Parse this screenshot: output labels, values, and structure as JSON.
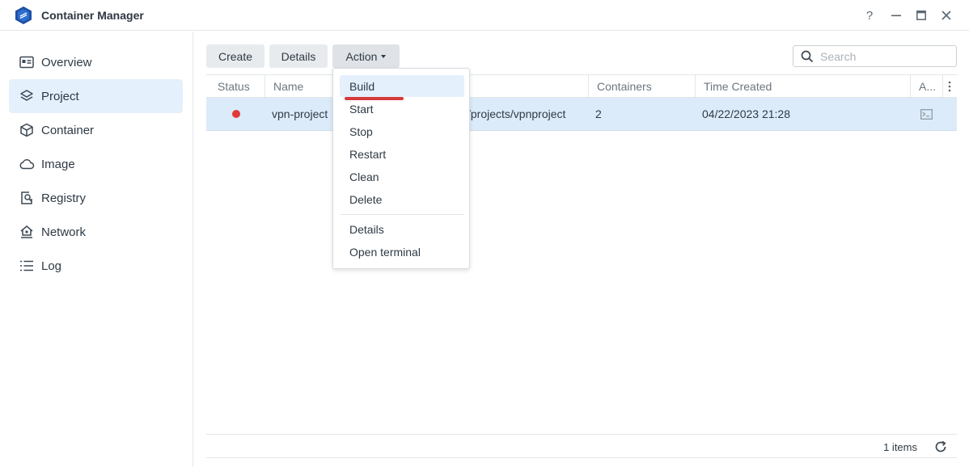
{
  "app": {
    "title": "Container Manager"
  },
  "window_controls": {
    "help": "?",
    "minimize": "—",
    "maximize": "□",
    "close": "✕"
  },
  "sidebar": {
    "items": [
      {
        "label": "Overview",
        "icon": "overview-icon",
        "active": false
      },
      {
        "label": "Project",
        "icon": "layers-icon",
        "active": true
      },
      {
        "label": "Container",
        "icon": "cube-icon",
        "active": false
      },
      {
        "label": "Image",
        "icon": "cloud-icon",
        "active": false
      },
      {
        "label": "Registry",
        "icon": "registry-icon",
        "active": false
      },
      {
        "label": "Network",
        "icon": "network-icon",
        "active": false
      },
      {
        "label": "Log",
        "icon": "list-icon",
        "active": false
      }
    ]
  },
  "toolbar": {
    "create_label": "Create",
    "details_label": "Details",
    "action_label": "Action",
    "search_placeholder": "Search"
  },
  "table": {
    "columns": [
      "Status",
      "Name",
      "Containers",
      "Time Created",
      "A..."
    ],
    "rows": [
      {
        "status_color": "#e03a3a",
        "name": "vpn-project",
        "path": "/projects/vpnproject",
        "containers": "2",
        "time_created": "04/22/2023 21:28"
      }
    ]
  },
  "footer": {
    "items_count": "1 items"
  },
  "action_menu": {
    "items": [
      "Build",
      "Start",
      "Stop",
      "Restart",
      "Clean",
      "Delete"
    ],
    "items2": [
      "Details",
      "Open terminal"
    ],
    "highlighted": "Build"
  },
  "colors": {
    "accent": "#e4f0fc",
    "selected_row": "#dcebfa",
    "annotation": "#d63a3a"
  }
}
